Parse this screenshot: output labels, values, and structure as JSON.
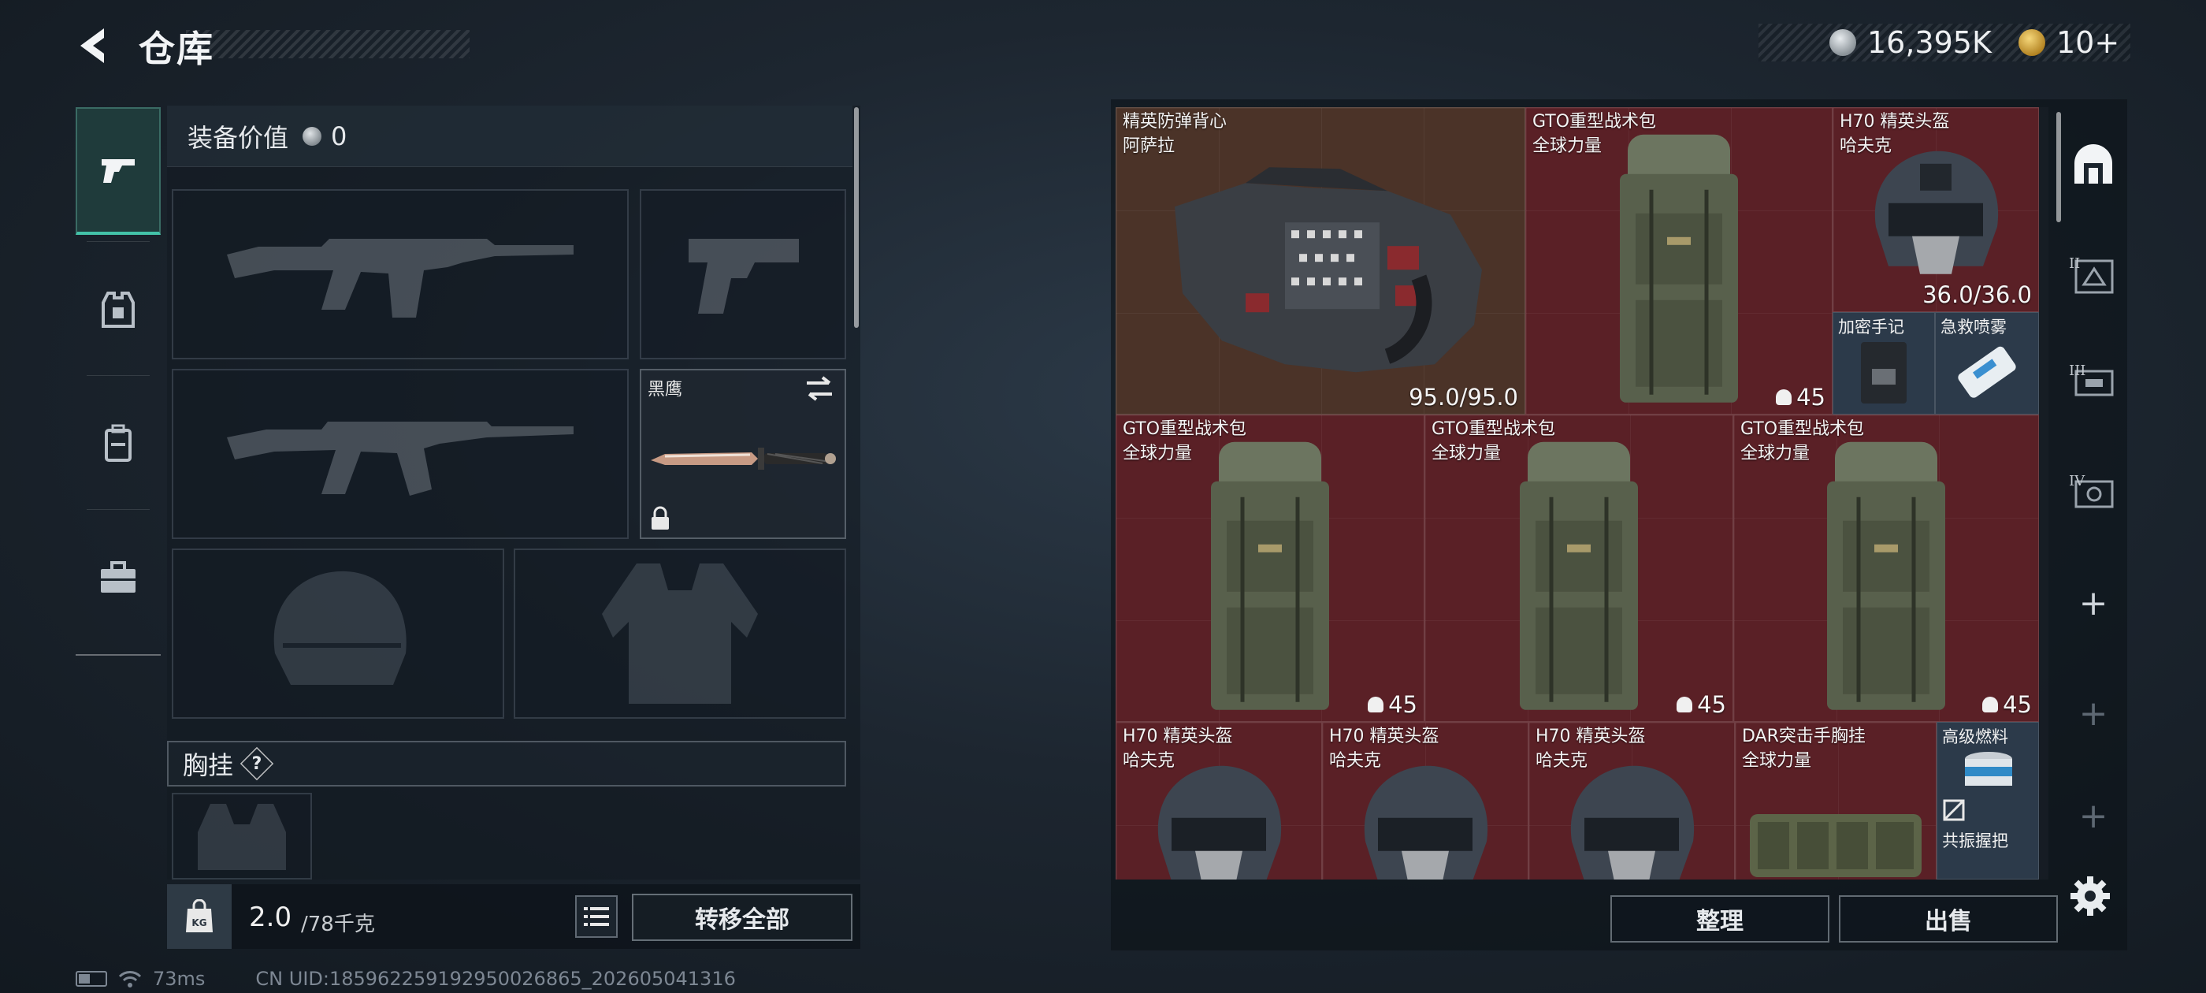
{
  "header": {
    "title": "仓库"
  },
  "currency": {
    "silver": "16,395K",
    "gold": "10+"
  },
  "loadout": {
    "equip_value_label": "装备价值",
    "equip_value": "0",
    "knife_name": "黑鹰",
    "rig_label": "胸挂",
    "rig_help": "?"
  },
  "footer": {
    "weight_current": "2.0",
    "weight_max": "/78千克",
    "transfer_all": "转移全部"
  },
  "stash": {
    "items": [
      {
        "name": "精英防弹背心",
        "sub": "阿萨拉",
        "durability": "95.0/95.0"
      },
      {
        "name": "GTO重型战术包",
        "sub": "全球力量",
        "cap": "45"
      },
      {
        "name": "H70 精英头盔",
        "sub": "哈夫克",
        "durability": "36.0/36.0"
      },
      {
        "name": "加密手记"
      },
      {
        "name": "急救喷雾"
      },
      {
        "name": "GTO重型战术包",
        "sub": "全球力量",
        "cap": "45"
      },
      {
        "name": "GTO重型战术包",
        "sub": "全球力量",
        "cap": "45"
      },
      {
        "name": "GTO重型战术包",
        "sub": "全球力量",
        "cap": "45"
      },
      {
        "name": "H70 精英头盔",
        "sub": "哈夫克"
      },
      {
        "name": "H70 精英头盔",
        "sub": "哈夫克"
      },
      {
        "name": "H70 精英头盔",
        "sub": "哈夫克"
      },
      {
        "name": "DAR突击手胸挂",
        "sub": "全球力量"
      },
      {
        "name": "高级燃料",
        "sub": "共振握把"
      }
    ],
    "sort_label": "整理",
    "sell_label": "出售"
  },
  "status": {
    "ping": "73ms",
    "uid": "CN UID:1859622591929500268​65_202605041316"
  }
}
